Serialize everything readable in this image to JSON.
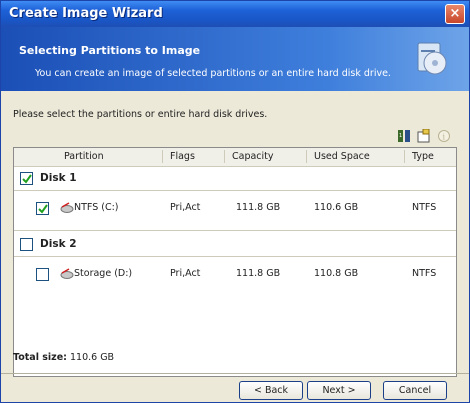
{
  "window": {
    "title": "Create Image Wizard",
    "close_label": "×"
  },
  "header": {
    "title": "Selecting Partitions to Image",
    "subtitle": "You can create an image of selected partitions or an entire hard disk drive."
  },
  "instruction": "Please select the partitions or entire hard disk drives.",
  "table": {
    "columns": [
      "Partition",
      "Flags",
      "Capacity",
      "Used Space",
      "Type"
    ],
    "disks": [
      {
        "label": "Disk 1",
        "checked": true,
        "partitions": [
          {
            "name": "NTFS (C:)",
            "flags": "Pri,Act",
            "capacity": "111.8 GB",
            "used": "110.6 GB",
            "type": "NTFS",
            "checked": true
          }
        ]
      },
      {
        "label": "Disk 2",
        "checked": false,
        "partitions": [
          {
            "name": "Storage (D:)",
            "flags": "Pri,Act",
            "capacity": "111.8 GB",
            "used": "110.8 GB",
            "type": "NTFS",
            "checked": false
          }
        ]
      }
    ]
  },
  "total": {
    "label": "Total size:",
    "value": "110.6 GB"
  },
  "buttons": {
    "back": "< Back",
    "next": "Next >",
    "cancel": "Cancel"
  },
  "icons": [
    "wizard-disk-icon",
    "sort-icon",
    "properties-icon",
    "info-icon",
    "partition-disk-icon"
  ],
  "colors": {
    "titlebar": "#1e62d8",
    "header": "#1b4fb6",
    "panel": "#ece9d8",
    "checkmark": "#21a121"
  }
}
